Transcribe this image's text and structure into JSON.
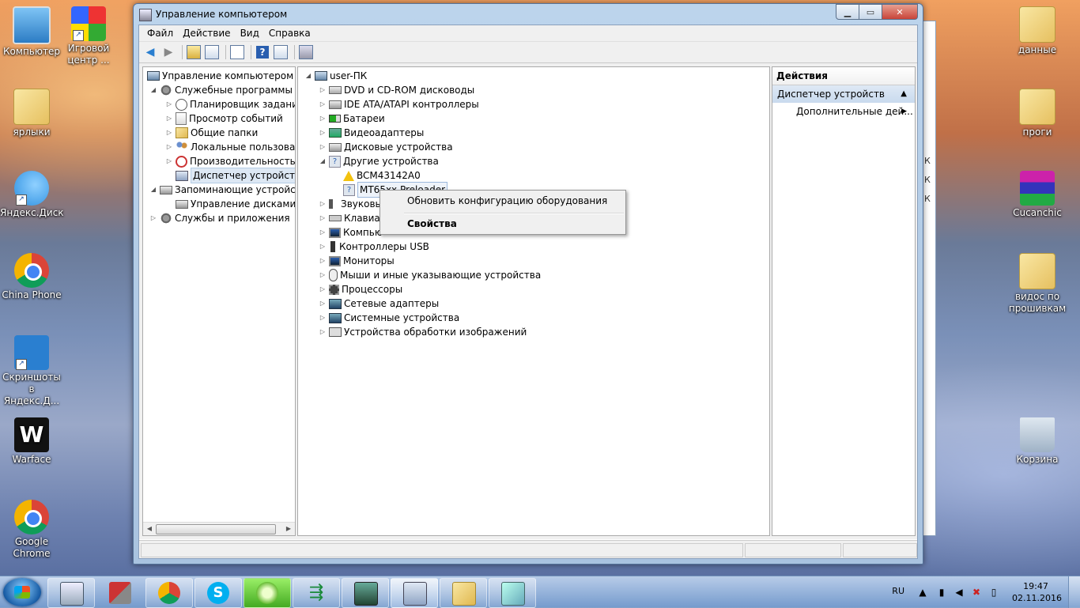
{
  "desktop": {
    "icons_left": [
      {
        "label": "Компьютер"
      },
      {
        "label": "Игровой центр ..."
      },
      {
        "label": "ярлыки"
      },
      {
        "label": "Яндекс.Диск"
      },
      {
        "label": "China Phone"
      },
      {
        "label": "Скриншоты в Яндекс.Д..."
      },
      {
        "label": "Warface"
      },
      {
        "label": "Google Chrome"
      }
    ],
    "icons_right": [
      {
        "label": "данные"
      },
      {
        "label": "проги"
      },
      {
        "label": "Cucanchic"
      },
      {
        "label": "видос по прошивкам"
      },
      {
        "label": "Корзина"
      }
    ]
  },
  "window": {
    "title": "Управление компьютером",
    "menu": [
      "Файл",
      "Действие",
      "Вид",
      "Справка"
    ]
  },
  "left_tree": {
    "root": "Управление компьютером (л",
    "items": [
      {
        "label": "Служебные программы"
      },
      {
        "label": "Планировщик заданий"
      },
      {
        "label": "Просмотр событий"
      },
      {
        "label": "Общие папки"
      },
      {
        "label": "Локальные пользовате"
      },
      {
        "label": "Производительность"
      },
      {
        "label": "Диспетчер устройств"
      },
      {
        "label": "Запоминающие устройст"
      },
      {
        "label": "Управление дисками"
      },
      {
        "label": "Службы и приложения"
      }
    ]
  },
  "device_tree": {
    "root": "user-ПК",
    "items": [
      {
        "label": "DVD и CD-ROM дисководы"
      },
      {
        "label": "IDE ATA/ATAPI контроллеры"
      },
      {
        "label": "Батареи"
      },
      {
        "label": "Видеоадаптеры"
      },
      {
        "label": "Дисковые устройства"
      },
      {
        "label": "Другие устройства"
      },
      {
        "label": "BCM43142A0"
      },
      {
        "label": "MT65xx Preloader"
      },
      {
        "label": "Звуковы"
      },
      {
        "label": "Клавиату"
      },
      {
        "label": "Компью"
      },
      {
        "label": "Контроллеры USB"
      },
      {
        "label": "Мониторы"
      },
      {
        "label": "Мыши и иные указывающие устройства"
      },
      {
        "label": "Процессоры"
      },
      {
        "label": "Сетевые адаптеры"
      },
      {
        "label": "Системные устройства"
      },
      {
        "label": "Устройства обработки изображений"
      }
    ]
  },
  "context_menu": {
    "item1": "Обновить конфигурацию оборудования",
    "item2": "Свойства"
  },
  "actions": {
    "header": "Действия",
    "section": "Диспетчер устройств",
    "item": "Дополнительные дей..."
  },
  "background_window": {
    "letters": [
      "К",
      "К",
      "К"
    ]
  },
  "taskbar": {
    "lang": "RU",
    "time": "19:47",
    "date": "02.11.2016"
  }
}
